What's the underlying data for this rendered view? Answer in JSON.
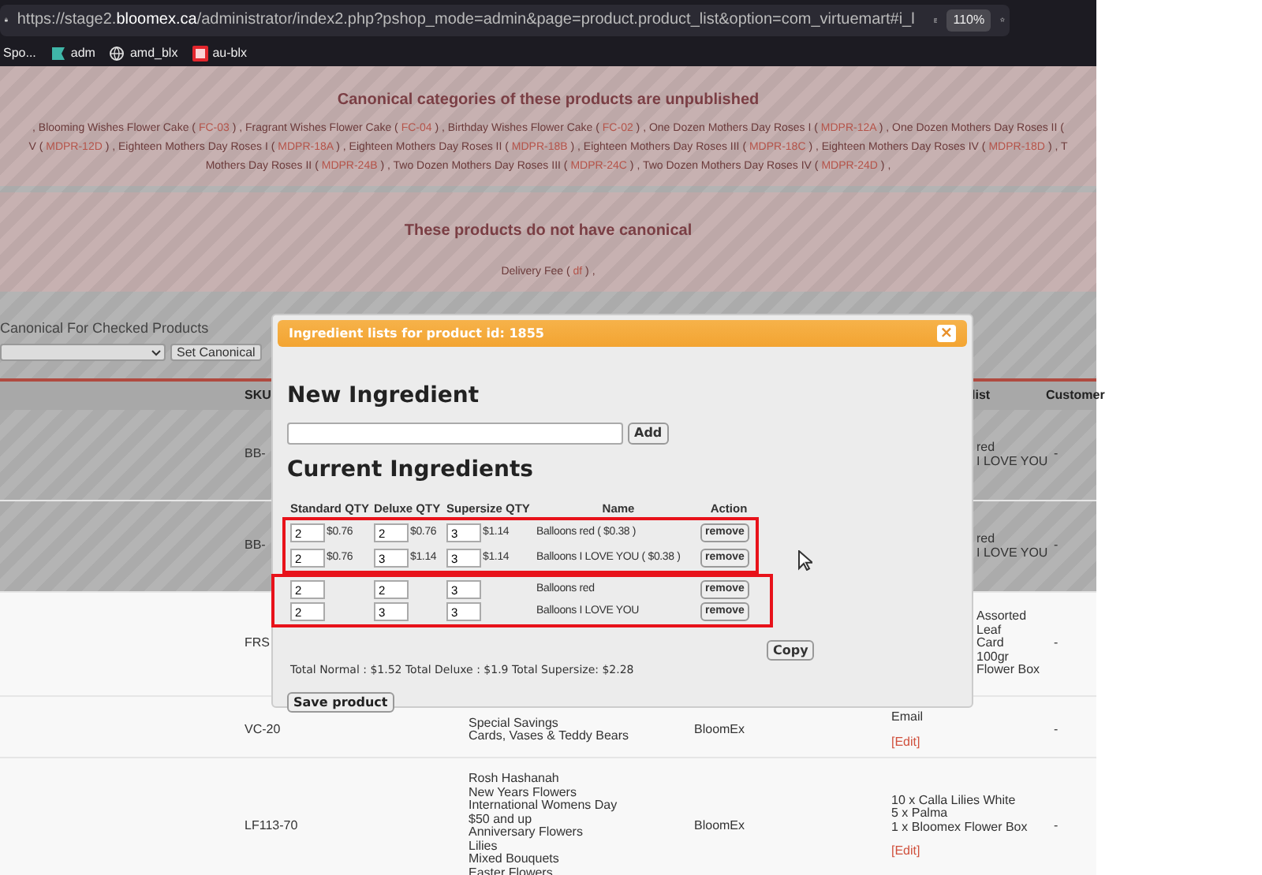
{
  "browser": {
    "url_prefix": "https://stage2.",
    "url_domain": "bloomex.ca",
    "url_path": "/administrator/index2.php?pshop_mode=admin&page=product.product_list&option=com_virtuemart#i_l",
    "zoom": "110%",
    "bookmarks": [
      {
        "label": "Spo..."
      },
      {
        "label": "adm"
      },
      {
        "label": "amd_blx"
      },
      {
        "label": "au-blx"
      }
    ]
  },
  "unpublished_banner": {
    "title": "Canonical categories of these products are unpublished",
    "lines": [
      [
        {
          "kind": "text",
          "text": ", Blooming Wishes Flower Cake ( "
        },
        {
          "kind": "link",
          "text": "FC-03"
        },
        {
          "kind": "text",
          "text": " ) , Fragrant Wishes Flower Cake ( "
        },
        {
          "kind": "link",
          "text": "FC-04"
        },
        {
          "kind": "text",
          "text": " ) , Birthday Wishes Flower Cake ( "
        },
        {
          "kind": "link",
          "text": "FC-02"
        },
        {
          "kind": "text",
          "text": " ) , One Dozen Mothers Day Roses I ( "
        },
        {
          "kind": "link",
          "text": "MDPR-12A"
        },
        {
          "kind": "text",
          "text": " ) , One Dozen Mothers Day Roses II ("
        }
      ],
      [
        {
          "kind": "text",
          "text": "V ( "
        },
        {
          "kind": "link",
          "text": "MDPR-12D"
        },
        {
          "kind": "text",
          "text": " ) , Eighteen Mothers Day Roses I ( "
        },
        {
          "kind": "link",
          "text": "MDPR-18A"
        },
        {
          "kind": "text",
          "text": " ) , Eighteen Mothers Day Roses II ( "
        },
        {
          "kind": "link",
          "text": "MDPR-18B"
        },
        {
          "kind": "text",
          "text": " ) , Eighteen Mothers Day Roses III ( "
        },
        {
          "kind": "link",
          "text": "MDPR-18C"
        },
        {
          "kind": "text",
          "text": " ) , Eighteen Mothers Day Roses IV ( "
        },
        {
          "kind": "link",
          "text": "MDPR-18D"
        },
        {
          "kind": "text",
          "text": " ) , T"
        }
      ],
      [
        {
          "kind": "text",
          "text": "Mothers Day Roses II ( "
        },
        {
          "kind": "link",
          "text": "MDPR-24B"
        },
        {
          "kind": "text",
          "text": " ) , Two Dozen Mothers Day Roses III ( "
        },
        {
          "kind": "link",
          "text": "MDPR-24C"
        },
        {
          "kind": "text",
          "text": " ) , Two Dozen Mothers Day Roses IV ( "
        },
        {
          "kind": "link",
          "text": "MDPR-24D"
        },
        {
          "kind": "text",
          "text": " ) ,"
        }
      ]
    ]
  },
  "no_canonical_banner": {
    "title": "These products do not have canonical",
    "lines": [
      [
        {
          "kind": "text",
          "text": "Delivery Fee ( "
        },
        {
          "kind": "link",
          "text": "df"
        },
        {
          "kind": "text",
          "text": " ) ,"
        }
      ]
    ]
  },
  "canonical_controls": {
    "label": "Canonical For Checked Products",
    "button": "Set Canonical"
  },
  "table": {
    "columns": [
      "SKU",
      "list",
      "Customer"
    ],
    "rows": [
      {
        "kind": "partial",
        "sku": "BB-",
        "ingredients": [
          "red",
          "I LOVE YOU"
        ],
        "customer": "-"
      },
      {
        "kind": "partial",
        "sku": "BB-",
        "ingredients": [
          "red",
          "I LOVE YOU"
        ],
        "customer": "-"
      },
      {
        "kind": "partial",
        "sku": "FRS",
        "ingredients": [
          "Assorted",
          "Leaf",
          "Card",
          "100gr",
          "Flower Box"
        ],
        "customer": "-"
      },
      {
        "kind": "full",
        "sku": "VC-20",
        "categories": [
          "Special Savings",
          "Cards, Vases & Teddy Bears"
        ],
        "manufacturer": "BloomEx",
        "ingredients": [
          "Email"
        ],
        "edit": "[Edit]",
        "customer": "-"
      },
      {
        "kind": "full",
        "sku": "LF113-70",
        "categories": [
          "Rosh Hashanah",
          "New Years Flowers",
          "International Womens Day",
          "$50 and up",
          "Anniversary Flowers",
          "Lilies",
          "Mixed Bouquets",
          "Easter Flowers"
        ],
        "manufacturer": "BloomEx",
        "ingredients": [
          "10 x Calla Lilies White",
          "5 x Palma",
          "1 x Bloomex Flower Box"
        ],
        "edit": "[Edit]",
        "customer": "-"
      }
    ]
  },
  "dialog": {
    "title": "Ingredient lists for product id: 1855",
    "close": "×",
    "new_heading": "New Ingredient",
    "add_button": "Add",
    "current_heading": "Current Ingredients",
    "columns": [
      "Standard QTY",
      "Deluxe QTY",
      "Supersize QTY",
      "Name",
      "Action"
    ],
    "groups": [
      {
        "highlighted": true,
        "rows": [
          {
            "standard": "2",
            "standard_price": "$0.76",
            "deluxe": "2",
            "deluxe_price": "$0.76",
            "supersize": "3",
            "supersize_price": "$1.14",
            "name": "Balloons red ( $0.38 )",
            "action": "remove"
          },
          {
            "standard": "2",
            "standard_price": "$0.76",
            "deluxe": "3",
            "deluxe_price": "$1.14",
            "supersize": "3",
            "supersize_price": "$1.14",
            "name": "Balloons I LOVE YOU ( $0.38 )",
            "action": "remove"
          }
        ]
      },
      {
        "highlighted": true,
        "rows": [
          {
            "standard": "2",
            "deluxe": "2",
            "supersize": "3",
            "name": "Balloons red",
            "action": "remove"
          },
          {
            "standard": "2",
            "deluxe": "3",
            "supersize": "3",
            "name": "Balloons I LOVE YOU",
            "action": "remove"
          }
        ]
      }
    ],
    "copy_button": "Copy",
    "totals": "Total Normal : $1.52 Total Deluxe : $1.9 Total Supersize: $2.28",
    "save_button": "Save product"
  }
}
